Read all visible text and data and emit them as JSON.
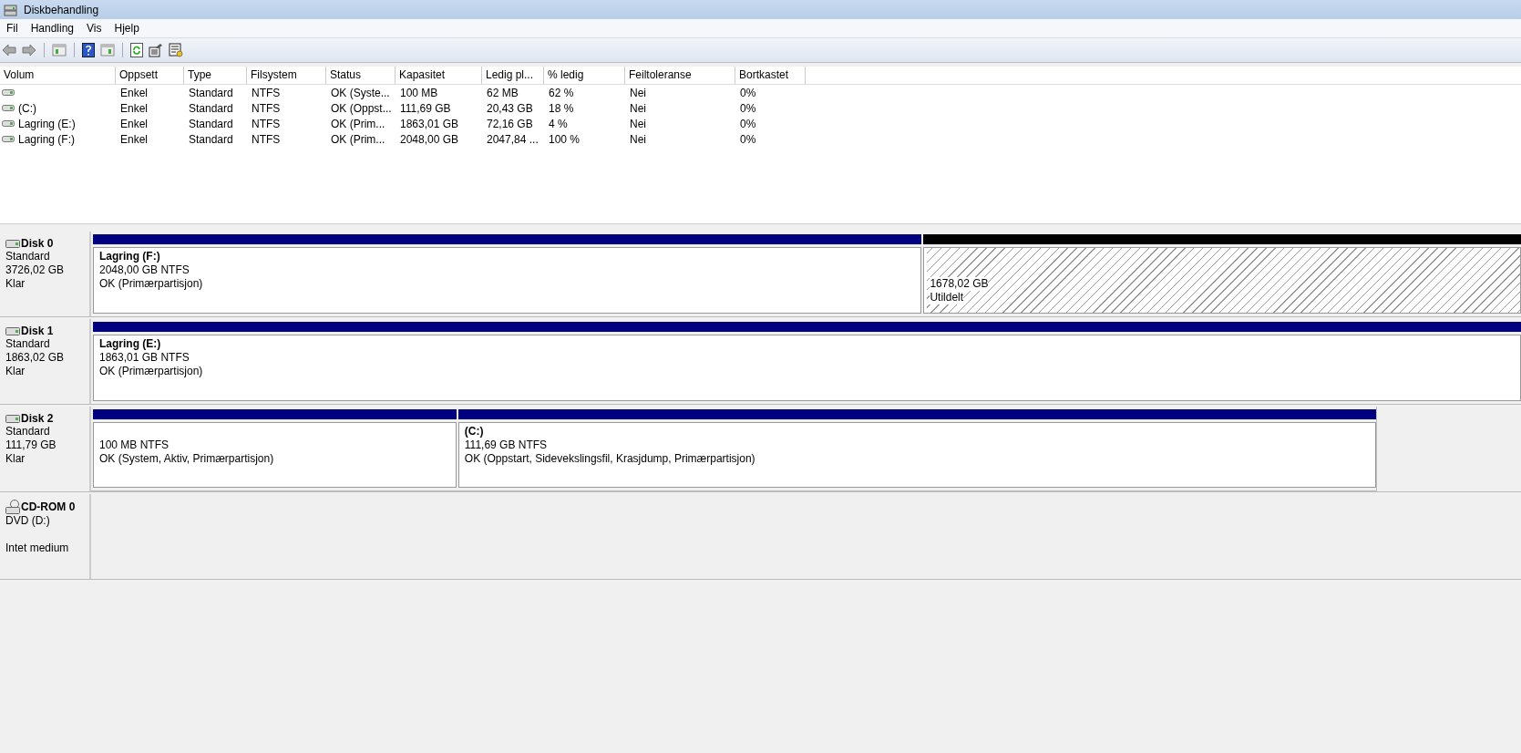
{
  "window": {
    "title": "Diskbehandling"
  },
  "menu": [
    "Fil",
    "Handling",
    "Vis",
    "Hjelp"
  ],
  "table": {
    "columns": [
      "Volum",
      "Oppsett",
      "Type",
      "Filsystem",
      "Status",
      "Kapasitet",
      "Ledig pl...",
      "% ledig",
      "Feiltoleranse",
      "Bortkastet"
    ],
    "rows": [
      [
        "",
        "Enkel",
        "Standard",
        "NTFS",
        "OK (Syste...",
        "100 MB",
        "62 MB",
        "62 %",
        "Nei",
        "0%"
      ],
      [
        "(C:)",
        "Enkel",
        "Standard",
        "NTFS",
        "OK (Oppst...",
        "111,69 GB",
        "20,43 GB",
        "18 %",
        "Nei",
        "0%"
      ],
      [
        "Lagring (E:)",
        "Enkel",
        "Standard",
        "NTFS",
        "OK (Prim...",
        "1863,01 GB",
        "72,16 GB",
        "4 %",
        "Nei",
        "0%"
      ],
      [
        "Lagring (F:)",
        "Enkel",
        "Standard",
        "NTFS",
        "OK (Prim...",
        "2048,00 GB",
        "2047,84 ...",
        "100 %",
        "Nei",
        "0%"
      ]
    ]
  },
  "disks": [
    {
      "kind": "disk",
      "name": "Disk 0",
      "type": "Standard",
      "size": "3726,02 GB",
      "status": "Klar",
      "partitions": [
        {
          "kind": "primary",
          "name": "Lagring  (F:)",
          "size": "2048,00 GB NTFS",
          "status": "OK (Primærpartisjon)"
        },
        {
          "kind": "unallocated",
          "size": "1678,02 GB",
          "status": "Utildelt"
        }
      ]
    },
    {
      "kind": "disk",
      "name": "Disk 1",
      "type": "Standard",
      "size": "1863,02 GB",
      "status": "Klar",
      "partitions": [
        {
          "kind": "primary",
          "name": "Lagring  (E:)",
          "size": "1863,01 GB NTFS",
          "status": "OK (Primærpartisjon)"
        }
      ]
    },
    {
      "kind": "disk",
      "name": "Disk 2",
      "type": "Standard",
      "size": "111,79 GB",
      "status": "Klar",
      "partitions": [
        {
          "kind": "primary",
          "size": "100 MB NTFS",
          "status": "OK (System, Aktiv, Primærpartisjon)"
        },
        {
          "kind": "primary",
          "name": "(C:)",
          "size": "111,69 GB NTFS",
          "status": "OK (Oppstart, Sidevekslingsfil, Krasjdump, Primærpartisjon)"
        }
      ]
    },
    {
      "kind": "cdrom",
      "name": "CD-ROM 0",
      "type": "DVD (D:)",
      "status": "Intet medium"
    }
  ]
}
